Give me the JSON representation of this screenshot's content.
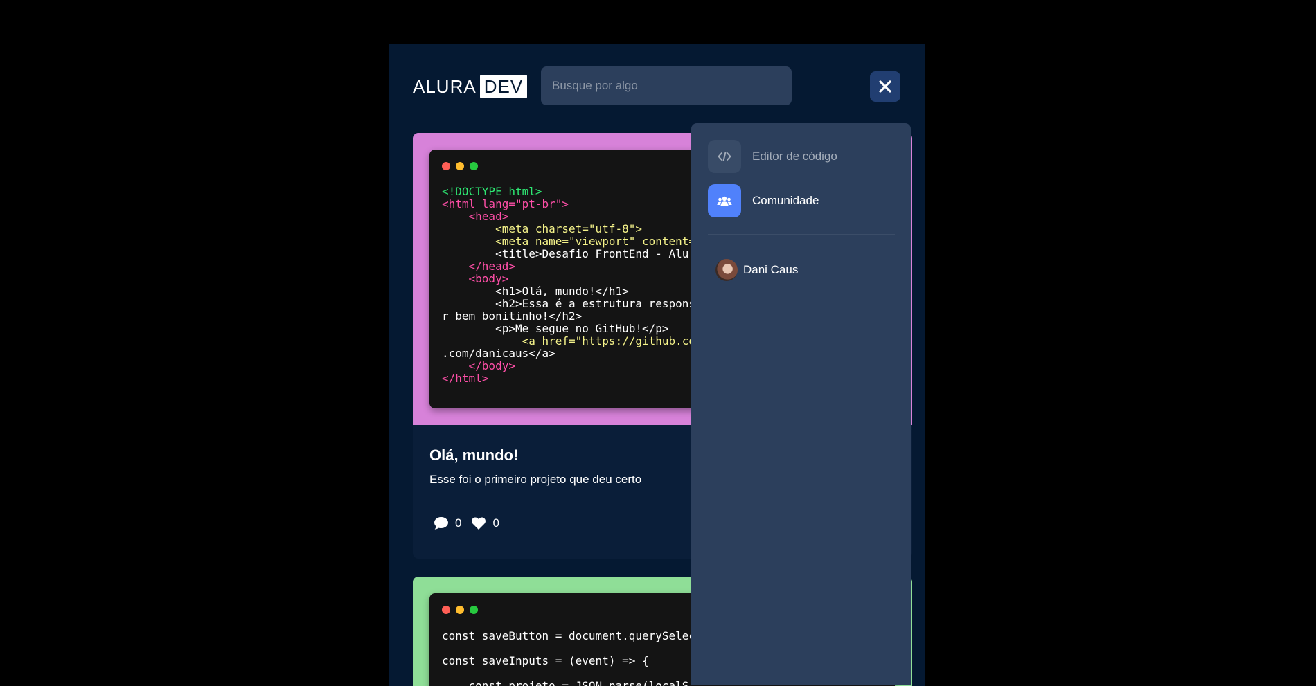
{
  "header": {
    "logo_text": "ALURA",
    "logo_box": "DEV",
    "search_placeholder": "Busque por algo"
  },
  "colors": {
    "background": "#000000",
    "frame": "#051932",
    "card": "#0a1e39",
    "menu": "#2c3f5c",
    "accent": "#5081fb",
    "card1_border": "#d782d9",
    "card2_border": "#8fde97"
  },
  "cards": [
    {
      "title": "Olá, mundo!",
      "description": "Esse foi o primeiro projeto que deu certo",
      "comments": "0",
      "likes": "0",
      "code_lines": [
        "<!DOCTYPE html>",
        "<html lang=\"pt-br\">",
        "    <head>",
        "        <meta charset=\"utf-8\">",
        "        <meta name=\"viewport\" content=",
        "        <title>Desafio FrontEnd - Alur",
        "    </head>",
        "    <body>",
        "        <h1>Olá, mundo!</h1>",
        "        <h2>Essa é a estrutura respons",
        "r bem bonitinho!</h2>",
        "        <p>Me segue no GitHub!</p>",
        "            <a href=\"https://github.co",
        ".com/danicaus</a>",
        "    </body>",
        "</html>"
      ]
    },
    {
      "code_lines": [
        "const saveButton = document.querySelec",
        "const saveInputs = (event) => {",
        "    const projeto = JSON.parse(localS"
      ]
    }
  ],
  "menu": {
    "items": [
      {
        "label": "Editor de código",
        "icon": "code-icon",
        "active": false
      },
      {
        "label": "Comunidade",
        "icon": "users-icon",
        "active": true
      }
    ],
    "user_name": "Dani Caus"
  }
}
